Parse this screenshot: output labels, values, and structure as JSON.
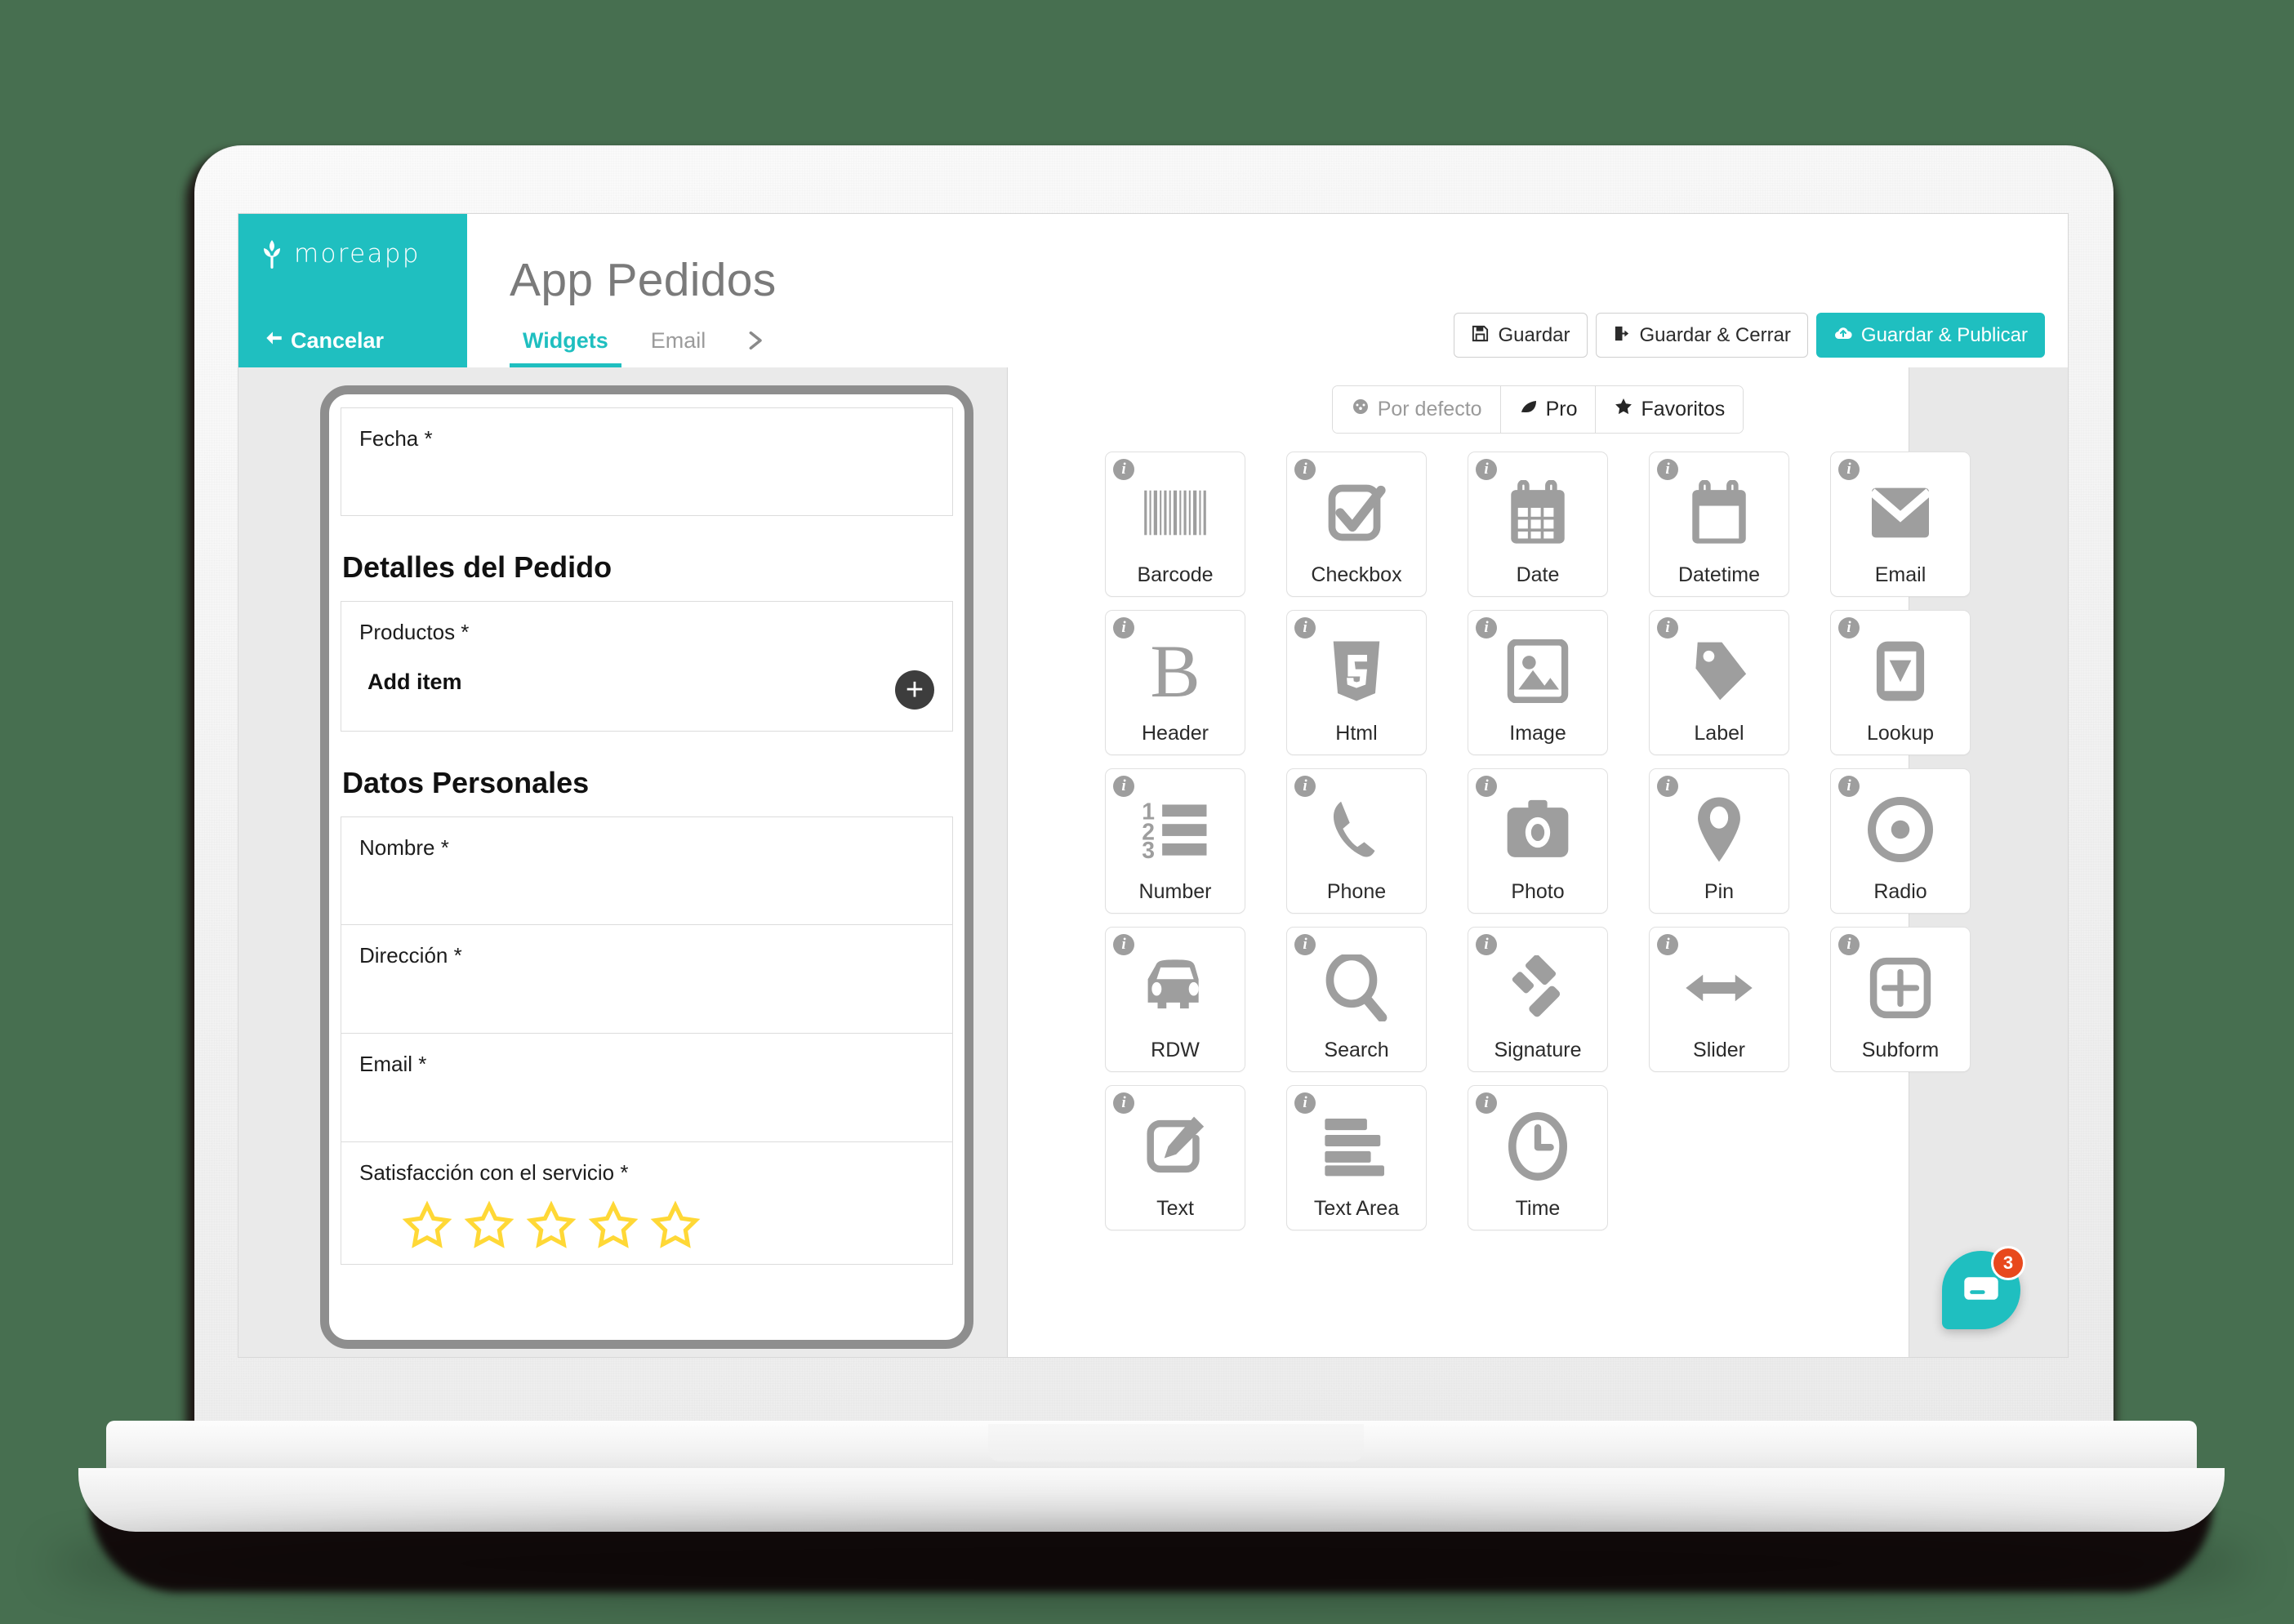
{
  "brand": {
    "name": "moreapp",
    "logo_icon": "wheat-icon",
    "accent": "#1fbfc0"
  },
  "header": {
    "title": "App Pedidos",
    "cancel_label": "Cancelar",
    "cancel_icon": "arrow-left-icon"
  },
  "tabs": [
    {
      "label": "Widgets",
      "active": true
    },
    {
      "label": "Email",
      "active": false
    }
  ],
  "tab_overflow_icon": "chevron-right-icon",
  "actions": [
    {
      "label": "Guardar",
      "icon": "save-floppy-icon",
      "primary": false
    },
    {
      "label": "Guardar & Cerrar",
      "icon": "sign-out-icon",
      "primary": false
    },
    {
      "label": "Guardar & Publicar",
      "icon": "cloud-upload-icon",
      "primary": true
    }
  ],
  "preview": {
    "fields": [
      {
        "type": "field",
        "label": "Fecha *"
      },
      {
        "type": "header",
        "label": "Detalles del Pedido"
      },
      {
        "type": "subform",
        "label": "Productos *",
        "add_label": "Add item",
        "add_icon": "plus-circle-icon"
      },
      {
        "type": "header",
        "label": "Datos Personales"
      },
      {
        "type": "field",
        "label": "Nombre *"
      },
      {
        "type": "field",
        "label": "Dirección *"
      },
      {
        "type": "field",
        "label": "Email *"
      },
      {
        "type": "rating",
        "label": "Satisfacción con el servicio *",
        "stars": 5,
        "filled": 0,
        "star_color": "#FFD836"
      }
    ]
  },
  "widget_panel": {
    "filters": [
      {
        "label": "Por defecto",
        "icon": "puzzle-icon",
        "active": false
      },
      {
        "label": "Pro",
        "icon": "leaf-icon",
        "active": true
      },
      {
        "label": "Favoritos",
        "icon": "star-icon",
        "active": true
      }
    ],
    "widgets": [
      {
        "label": "Barcode",
        "icon": "barcode-icon"
      },
      {
        "label": "Checkbox",
        "icon": "checkbox-icon"
      },
      {
        "label": "Date",
        "icon": "calendar-icon"
      },
      {
        "label": "Datetime",
        "icon": "calendar-blank-icon"
      },
      {
        "label": "Email",
        "icon": "envelope-icon"
      },
      {
        "label": "Header",
        "icon": "bold-b-icon"
      },
      {
        "label": "Html",
        "icon": "html5-icon"
      },
      {
        "label": "Image",
        "icon": "image-icon"
      },
      {
        "label": "Label",
        "icon": "tag-icon"
      },
      {
        "label": "Lookup",
        "icon": "dropdown-icon"
      },
      {
        "label": "Number",
        "icon": "ordered-list-icon"
      },
      {
        "label": "Phone",
        "icon": "phone-icon"
      },
      {
        "label": "Photo",
        "icon": "camera-icon"
      },
      {
        "label": "Pin",
        "icon": "map-pin-icon"
      },
      {
        "label": "Radio",
        "icon": "radio-circle-icon"
      },
      {
        "label": "RDW",
        "icon": "car-icon"
      },
      {
        "label": "Search",
        "icon": "magnifier-icon"
      },
      {
        "label": "Signature",
        "icon": "gavel-icon"
      },
      {
        "label": "Slider",
        "icon": "arrows-horizontal-icon"
      },
      {
        "label": "Subform",
        "icon": "plus-square-icon"
      },
      {
        "label": "Text",
        "icon": "pencil-square-icon"
      },
      {
        "label": "Text Area",
        "icon": "lines-icon"
      },
      {
        "label": "Time",
        "icon": "clock-icon"
      }
    ],
    "info_badge": "i"
  },
  "chat": {
    "icon": "chat-bubble-icon",
    "unread": "3",
    "badge_color": "#e8491d"
  }
}
